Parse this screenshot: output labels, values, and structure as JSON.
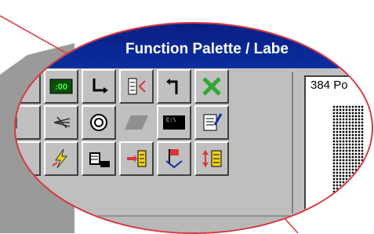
{
  "window": {
    "title": "Function Palette / Labe"
  },
  "palette": {
    "rows": [
      [
        "partial-left-icon",
        "function-count-icon",
        "return-arrow-icon",
        "branch-column-icon",
        "up-arrow-icon",
        "close-x-icon"
      ],
      [
        "partial-left-icon",
        "scatter-icon",
        "sensor-icon",
        "parallelogram-icon",
        "console-icon",
        "edit-note-icon"
      ],
      [
        "partial-left-icon",
        "lightning-icon",
        "hand-device-icon",
        "insert-list-icon",
        "flag-drop-icon",
        "sort-list-icon"
      ]
    ],
    "counter_label": ":00"
  },
  "label_panel": {
    "text": "384 Po"
  },
  "colors": {
    "title_bg": "#0b2ea0",
    "title_fg": "#ffffff",
    "button_face": "#c0c0c0",
    "callout_red": "#d9363e",
    "counter_green": "#1f8f1f",
    "close_green": "#2fa82f",
    "lightning_yellow": "#f2d21a"
  }
}
